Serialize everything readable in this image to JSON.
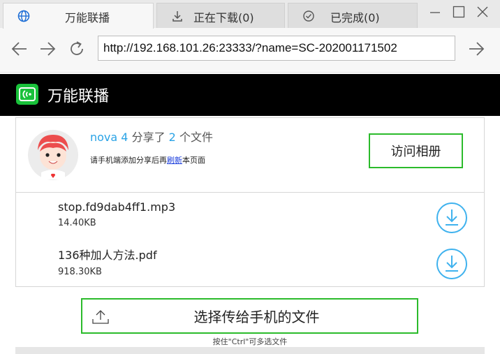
{
  "tabs": [
    {
      "label": "万能联播",
      "icon": "globe-icon",
      "active": true
    },
    {
      "label": "正在下载(0)",
      "icon": "download-icon",
      "active": false
    },
    {
      "label": "已完成(0)",
      "icon": "check-circle-icon",
      "active": false
    }
  ],
  "window_controls": {
    "minimize_icon": "minimize-icon",
    "maximize_icon": "maximize-icon",
    "close_icon": "close-icon"
  },
  "address": {
    "url": "http://192.168.101.26:23333/?name=SC-202001171502"
  },
  "app": {
    "title": "万能联播",
    "logo_color": "#19c13a"
  },
  "share": {
    "user": "nova 4",
    "shared_text": "分享了",
    "count": "2",
    "count_suffix": "个文件",
    "hint_before": "请手机端添加分享后再",
    "hint_link": "刷新",
    "hint_after": "本页面",
    "album_button": "访问相册"
  },
  "files": [
    {
      "name": "stop.fd9dab4ff1.mp3",
      "size": "14.40KB"
    },
    {
      "name": "136种加人方法.pdf",
      "size": "918.30KB"
    }
  ],
  "upload": {
    "label": "选择传给手机的文件",
    "hint": "按住\"Ctrl\"可多选文件"
  },
  "colors": {
    "accent_green": "#2bbb2b",
    "link_blue": "#2aa3e6",
    "download_blue": "#3fb2ee"
  }
}
